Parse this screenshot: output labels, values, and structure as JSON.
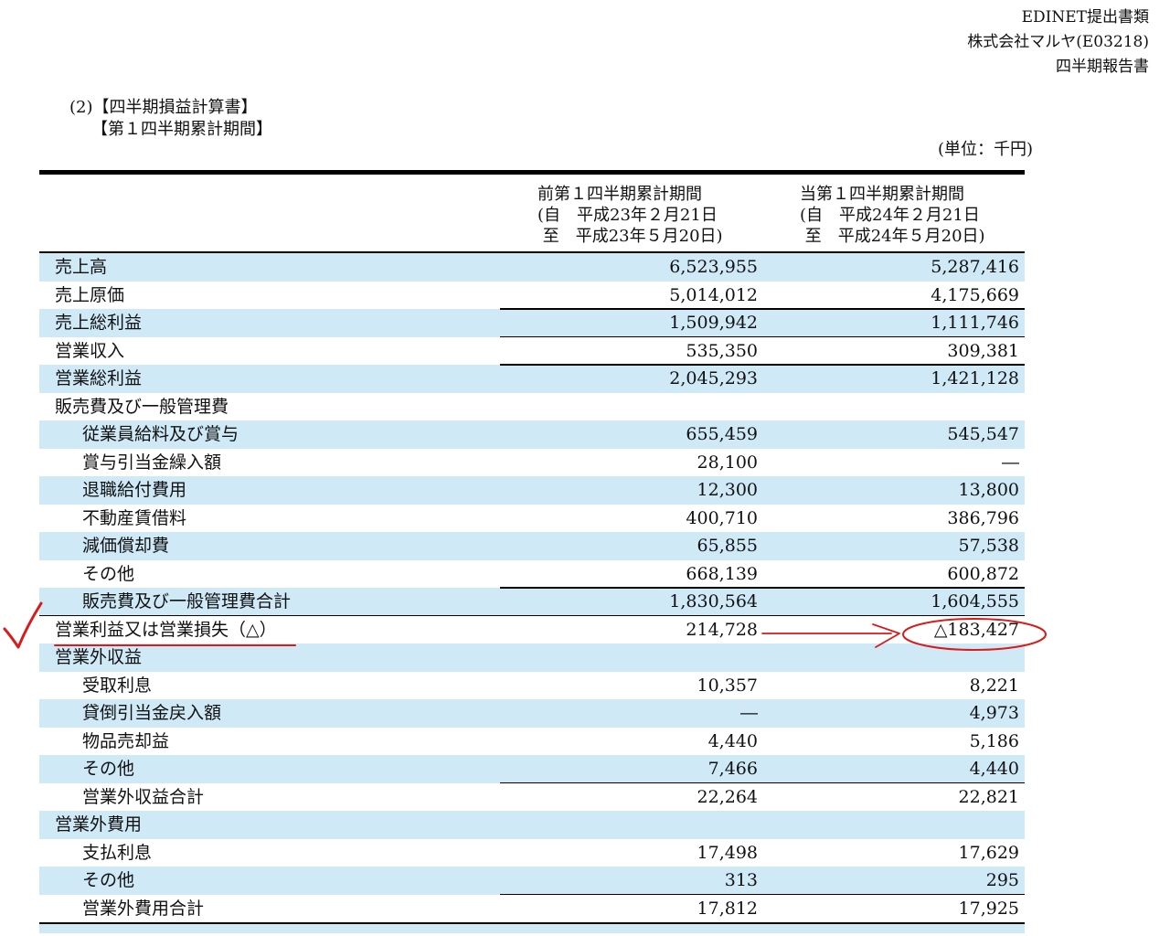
{
  "header": {
    "line1": "EDINET提出書類",
    "line2": "株式会社マルヤ(E03218)",
    "line3": "四半期報告書"
  },
  "section": {
    "title": "(2)【四半期損益計算書】",
    "subtitle": "【第１四半期累計期間】",
    "unit": "(単位：千円)"
  },
  "columns": {
    "prev": "前第１四半期累計期間\n(自　平成23年２月21日\n 至　平成23年５月20日)",
    "curr": "当第１四半期累計期間\n(自　平成24年２月21日\n 至　平成24年５月20日)"
  },
  "rows": [
    {
      "label": "売上高",
      "prev": "6,523,955",
      "curr": "5,287,416"
    },
    {
      "label": "売上原価",
      "prev": "5,014,012",
      "curr": "4,175,669"
    },
    {
      "label": "売上総利益",
      "prev": "1,509,942",
      "curr": "1,111,746"
    },
    {
      "label": "営業収入",
      "prev": "535,350",
      "curr": "309,381"
    },
    {
      "label": "営業総利益",
      "prev": "2,045,293",
      "curr": "1,421,128"
    },
    {
      "label": "販売費及び一般管理費",
      "prev": "",
      "curr": ""
    },
    {
      "label": "従業員給料及び賞与",
      "prev": "655,459",
      "curr": "545,547"
    },
    {
      "label": "賞与引当金繰入額",
      "prev": "28,100",
      "curr": "―"
    },
    {
      "label": "退職給付費用",
      "prev": "12,300",
      "curr": "13,800"
    },
    {
      "label": "不動産賃借料",
      "prev": "400,710",
      "curr": "386,796"
    },
    {
      "label": "減価償却費",
      "prev": "65,855",
      "curr": "57,538"
    },
    {
      "label": "その他",
      "prev": "668,139",
      "curr": "600,872"
    },
    {
      "label": "販売費及び一般管理費合計",
      "prev": "1,830,564",
      "curr": "1,604,555"
    },
    {
      "label": "営業利益又は営業損失（△）",
      "prev": "214,728",
      "curr": "△183,427"
    },
    {
      "label": "営業外収益",
      "prev": "",
      "curr": ""
    },
    {
      "label": "受取利息",
      "prev": "10,357",
      "curr": "8,221"
    },
    {
      "label": "貸倒引当金戻入額",
      "prev": "―",
      "curr": "4,973"
    },
    {
      "label": "物品売却益",
      "prev": "4,440",
      "curr": "5,186"
    },
    {
      "label": "その他",
      "prev": "7,466",
      "curr": "4,440"
    },
    {
      "label": "営業外収益合計",
      "prev": "22,264",
      "curr": "22,821"
    },
    {
      "label": "営業外費用",
      "prev": "",
      "curr": ""
    },
    {
      "label": "支払利息",
      "prev": "17,498",
      "curr": "17,629"
    },
    {
      "label": "その他",
      "prev": "313",
      "curr": "295"
    },
    {
      "label": "営業外費用合計",
      "prev": "17,812",
      "curr": "17,925"
    }
  ],
  "annotation": {
    "color": "#d81b1b"
  }
}
